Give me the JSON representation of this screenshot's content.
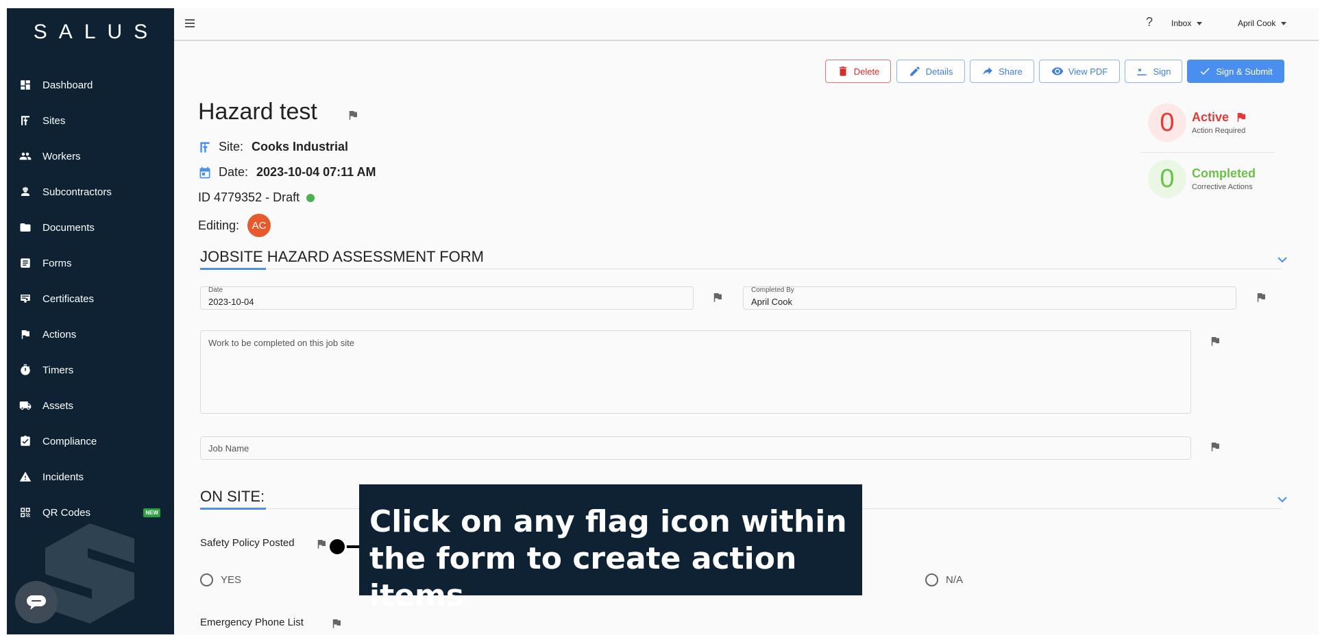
{
  "app": {
    "logo": "SALUS"
  },
  "sidebar": {
    "items": [
      {
        "label": "Dashboard",
        "icon": "dashboard-icon"
      },
      {
        "label": "Sites",
        "icon": "crane-icon"
      },
      {
        "label": "Workers",
        "icon": "people-icon"
      },
      {
        "label": "Subcontractors",
        "icon": "engineer-icon"
      },
      {
        "label": "Documents",
        "icon": "folder-icon"
      },
      {
        "label": "Forms",
        "icon": "form-icon"
      },
      {
        "label": "Certificates",
        "icon": "certificate-icon"
      },
      {
        "label": "Actions",
        "icon": "flag-icon"
      },
      {
        "label": "Timers",
        "icon": "timer-icon"
      },
      {
        "label": "Assets",
        "icon": "truck-icon"
      },
      {
        "label": "Compliance",
        "icon": "checklist-icon"
      },
      {
        "label": "Incidents",
        "icon": "warning-icon"
      },
      {
        "label": "QR Codes",
        "icon": "qr-code-icon",
        "badge": "NEW"
      }
    ]
  },
  "topbar": {
    "help": "?",
    "inbox": "Inbox",
    "user": "April Cook"
  },
  "toolbar": {
    "delete": "Delete",
    "details": "Details",
    "share": "Share",
    "view_pdf": "View PDF",
    "sign": "Sign",
    "sign_submit": "Sign & Submit"
  },
  "record": {
    "title": "Hazard test",
    "site_label": "Site:",
    "site_value": "Cooks Industrial",
    "date_label": "Date:",
    "date_value": "2023-10-04 07:11 AM",
    "id_text": "ID 4779352 - Draft",
    "editing_label": "Editing:",
    "editor_initials": "AC"
  },
  "stats": {
    "active": {
      "count": "0",
      "label": "Active",
      "sub": "Action Required",
      "color": "#e53935"
    },
    "completed": {
      "count": "0",
      "label": "Completed",
      "sub": "Corrective Actions",
      "color": "#6cc04a"
    }
  },
  "form": {
    "section1_title": "JOBSITE HAZARD ASSESSMENT FORM",
    "date_label": "Date",
    "date_value": "2023-10-04",
    "completed_by_label": "Completed By",
    "completed_by_value": "April Cook",
    "work_placeholder": "Work to be completed on this job site",
    "job_name_placeholder": "Job Name",
    "section2_title": "ON SITE:",
    "q1_label": "Safety Policy Posted",
    "opt_yes": "YES",
    "opt_na": "N/A",
    "q2_label": "Emergency Phone List"
  },
  "callout": {
    "text": "Click on any flag icon within the form to create action items"
  },
  "colors": {
    "sidebar": "#0e2233",
    "accent": "#4a8ef0",
    "danger": "#d32f2f"
  }
}
